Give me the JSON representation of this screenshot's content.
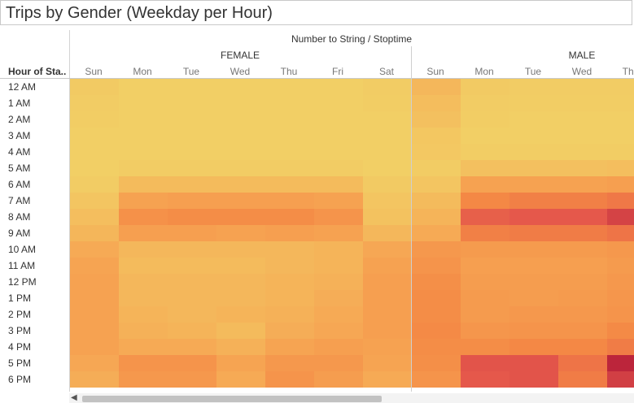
{
  "title": "Trips by Gender (Weekday per Hour)",
  "chart_data": {
    "type": "heatmap",
    "column_header": "Number to String / Stoptime",
    "row_header": "Hour of Sta..",
    "genders": [
      {
        "name": "FEMALE",
        "days": [
          "Sun",
          "Mon",
          "Tue",
          "Wed",
          "Thu",
          "Fri",
          "Sat"
        ]
      },
      {
        "name": "MALE",
        "days": [
          "Sun",
          "Mon",
          "Tue",
          "Wed",
          "Thu"
        ]
      }
    ],
    "hours": [
      "12 AM",
      "1 AM",
      "2 AM",
      "3 AM",
      "4 AM",
      "5 AM",
      "6 AM",
      "7 AM",
      "8 AM",
      "9 AM",
      "10 AM",
      "11 AM",
      "12 PM",
      "1 PM",
      "2 PM",
      "3 PM",
      "4 PM",
      "5 PM",
      "6 PM"
    ],
    "color_scale": [
      "#f2cf65",
      "#f6a553",
      "#f48845",
      "#e4564b",
      "#b8213a"
    ],
    "intensity": [
      [
        0.03,
        0.0,
        0.0,
        0.0,
        0.0,
        0.0,
        0.02,
        0.14,
        0.03,
        0.02,
        0.02,
        0.02
      ],
      [
        0.02,
        0.0,
        0.0,
        0.0,
        0.0,
        0.0,
        0.01,
        0.11,
        0.02,
        0.01,
        0.01,
        0.01
      ],
      [
        0.01,
        0.0,
        0.0,
        0.0,
        0.0,
        0.0,
        0.0,
        0.09,
        0.01,
        0.0,
        0.0,
        0.0
      ],
      [
        0.0,
        0.0,
        0.0,
        0.0,
        0.0,
        0.0,
        0.0,
        0.05,
        0.0,
        0.0,
        0.0,
        0.0
      ],
      [
        0.0,
        0.0,
        0.0,
        0.0,
        0.0,
        0.0,
        0.0,
        0.04,
        0.01,
        0.01,
        0.01,
        0.01
      ],
      [
        0.0,
        0.02,
        0.02,
        0.02,
        0.02,
        0.02,
        0.0,
        0.02,
        0.09,
        0.09,
        0.09,
        0.1
      ],
      [
        0.02,
        0.12,
        0.12,
        0.12,
        0.12,
        0.12,
        0.03,
        0.06,
        0.28,
        0.28,
        0.28,
        0.3
      ],
      [
        0.06,
        0.28,
        0.3,
        0.3,
        0.3,
        0.28,
        0.06,
        0.12,
        0.5,
        0.54,
        0.54,
        0.58
      ],
      [
        0.1,
        0.42,
        0.46,
        0.46,
        0.46,
        0.4,
        0.08,
        0.16,
        0.7,
        0.74,
        0.74,
        0.84
      ],
      [
        0.15,
        0.3,
        0.3,
        0.28,
        0.3,
        0.28,
        0.14,
        0.22,
        0.54,
        0.56,
        0.56,
        0.6
      ],
      [
        0.22,
        0.14,
        0.14,
        0.14,
        0.14,
        0.16,
        0.24,
        0.36,
        0.34,
        0.34,
        0.34,
        0.36
      ],
      [
        0.26,
        0.12,
        0.12,
        0.12,
        0.14,
        0.16,
        0.28,
        0.4,
        0.3,
        0.3,
        0.3,
        0.34
      ],
      [
        0.28,
        0.14,
        0.14,
        0.14,
        0.16,
        0.18,
        0.3,
        0.44,
        0.32,
        0.32,
        0.32,
        0.36
      ],
      [
        0.28,
        0.14,
        0.14,
        0.14,
        0.16,
        0.2,
        0.3,
        0.46,
        0.34,
        0.32,
        0.34,
        0.38
      ],
      [
        0.28,
        0.16,
        0.14,
        0.16,
        0.18,
        0.22,
        0.3,
        0.46,
        0.34,
        0.36,
        0.36,
        0.4
      ],
      [
        0.28,
        0.18,
        0.16,
        0.12,
        0.2,
        0.24,
        0.3,
        0.48,
        0.38,
        0.4,
        0.4,
        0.48
      ],
      [
        0.28,
        0.22,
        0.22,
        0.18,
        0.26,
        0.3,
        0.28,
        0.46,
        0.46,
        0.5,
        0.5,
        0.56
      ],
      [
        0.24,
        0.4,
        0.4,
        0.26,
        0.36,
        0.36,
        0.26,
        0.44,
        0.76,
        0.76,
        0.6,
        0.98
      ],
      [
        0.2,
        0.36,
        0.36,
        0.22,
        0.4,
        0.32,
        0.22,
        0.4,
        0.74,
        0.76,
        0.56,
        0.86
      ]
    ]
  }
}
